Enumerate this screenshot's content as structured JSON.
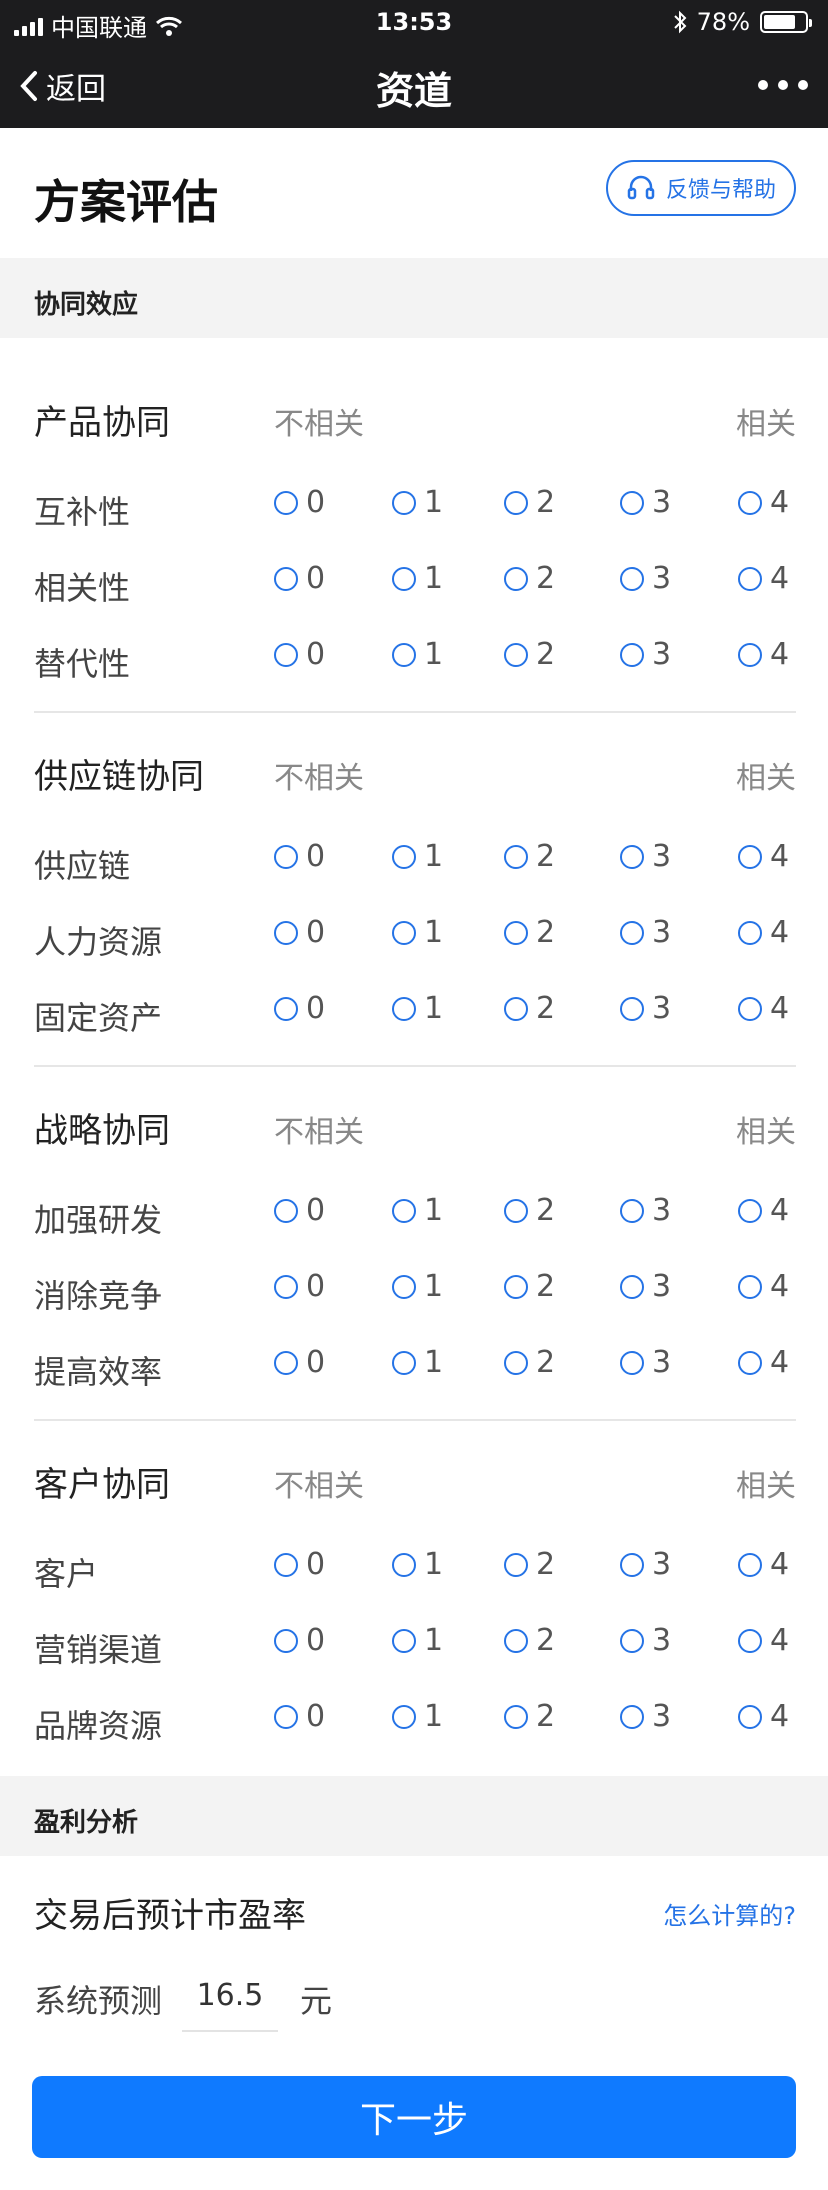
{
  "status": {
    "carrier": "中国联通",
    "time": "13:53",
    "battery": "78%",
    "battery_level": 0.78
  },
  "nav": {
    "back_label": "返回",
    "title": "资道"
  },
  "header": {
    "title": "方案评估",
    "help_label": "反馈与帮助"
  },
  "sections": {
    "synergy_label": "协同效应",
    "profit_label": "盈利分析"
  },
  "scale": {
    "low": "不相关",
    "high": "相关",
    "options": [
      "0",
      "1",
      "2",
      "3",
      "4"
    ]
  },
  "groups": [
    {
      "title": "产品协同",
      "rows": [
        "互补性",
        "相关性",
        "替代性"
      ]
    },
    {
      "title": "供应链协同",
      "rows": [
        "供应链",
        "人力资源",
        "固定资产"
      ]
    },
    {
      "title": "战略协同",
      "rows": [
        "加强研发",
        "消除竞争",
        "提高效率"
      ]
    },
    {
      "title": "客户协同",
      "rows": [
        "客户",
        "营销渠道",
        "品牌资源"
      ]
    }
  ],
  "profit": {
    "title": "交易后预计市盈率",
    "howto_label": "怎么计算的?",
    "predict_label": "系统预测",
    "predict_value": "16.5",
    "unit": "元"
  },
  "footer": {
    "next_label": "下一步"
  },
  "colors": {
    "accent": "#2573e6",
    "button": "#0f7aff",
    "navbar": "#1c1c1e"
  }
}
